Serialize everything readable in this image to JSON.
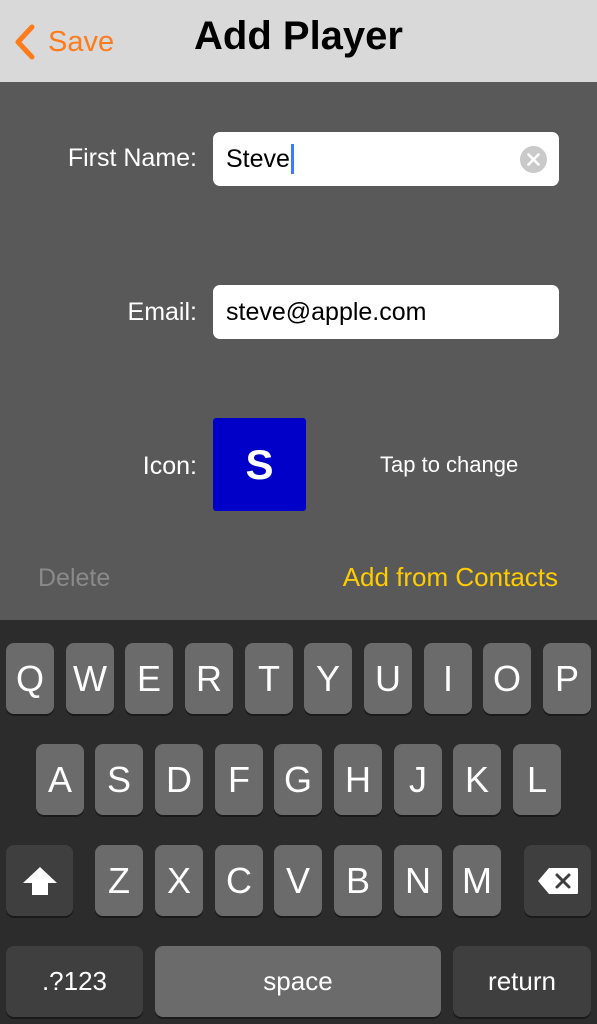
{
  "nav": {
    "back_label": "Save",
    "title": "Add Player"
  },
  "form": {
    "first_name_label": "First Name:",
    "first_name_value": "Steve",
    "email_label": "Email:",
    "email_value": "steve@apple.com",
    "icon_label": "Icon:",
    "icon_letter": "S",
    "icon_color": "#0000c8",
    "tap_to_change": "Tap to change",
    "delete_label": "Delete",
    "add_contacts_label": "Add from Contacts"
  },
  "colors": {
    "accent_orange": "#ff7a1a",
    "accent_yellow": "#ffcc00",
    "cursor_blue": "#3c7bff"
  },
  "keyboard": {
    "row1": [
      "Q",
      "W",
      "E",
      "R",
      "T",
      "Y",
      "U",
      "I",
      "O",
      "P"
    ],
    "row2": [
      "A",
      "S",
      "D",
      "F",
      "G",
      "H",
      "J",
      "K",
      "L"
    ],
    "row3": [
      "Z",
      "X",
      "C",
      "V",
      "B",
      "N",
      "M"
    ],
    "shift_icon": "shift-icon",
    "backspace_icon": "backspace-icon",
    "numbers_label": ".?123",
    "space_label": "space",
    "return_label": "return"
  }
}
